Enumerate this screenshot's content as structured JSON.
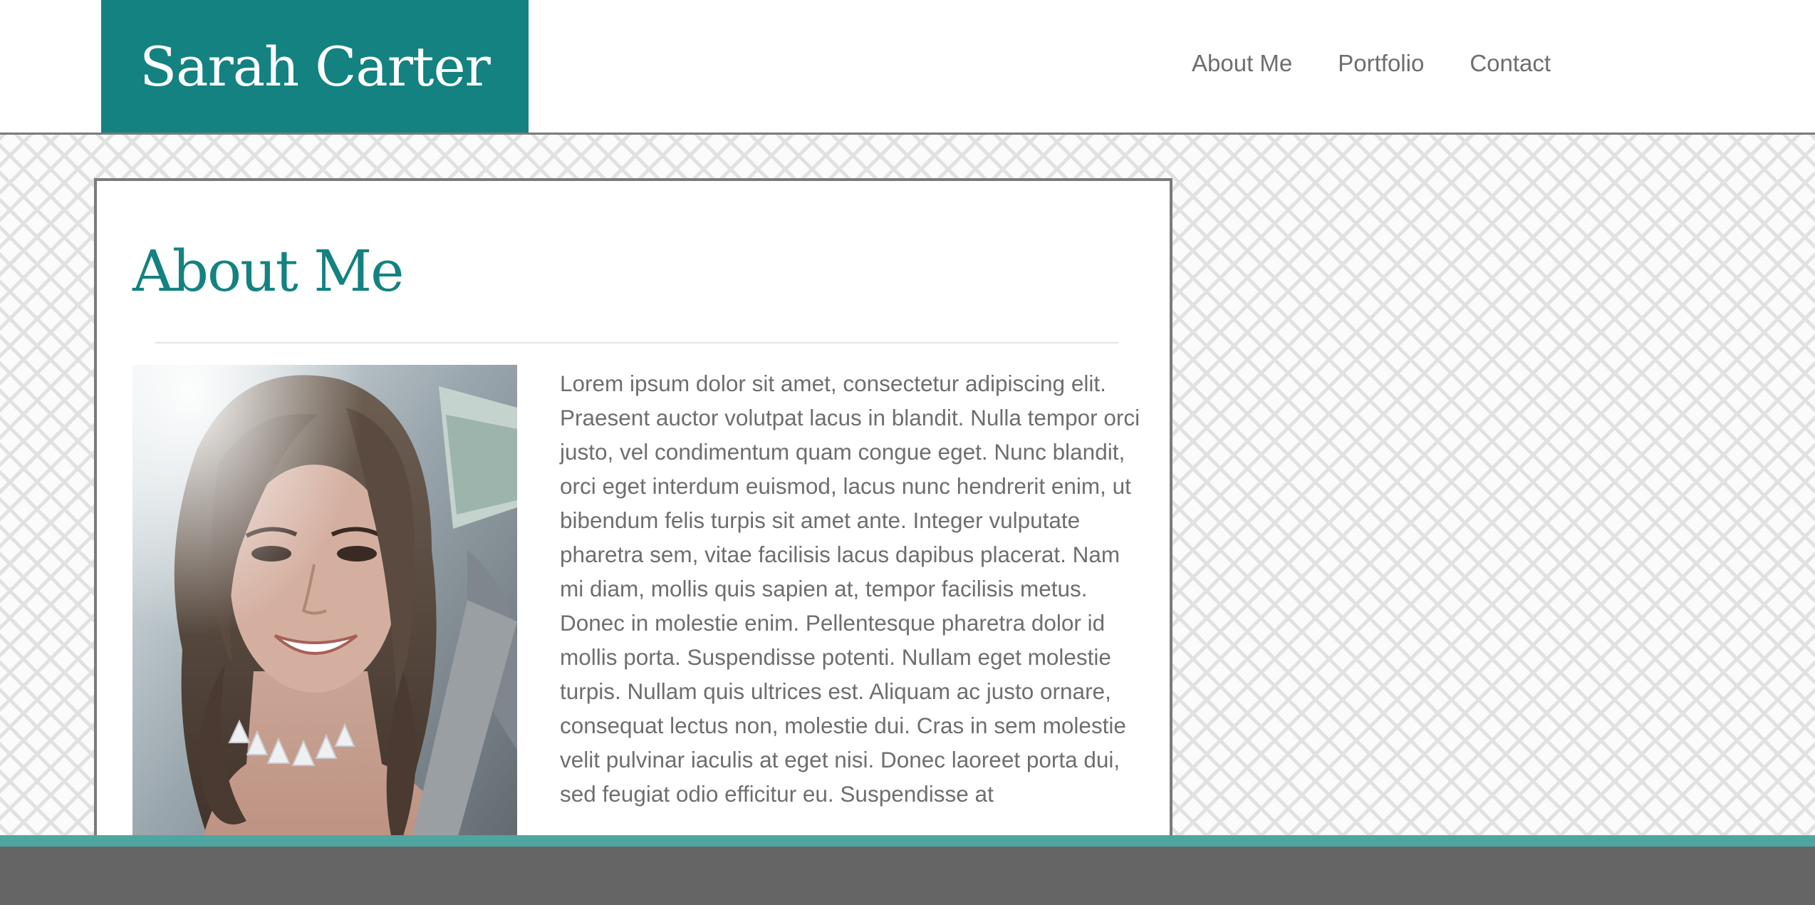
{
  "header": {
    "site_title": "Sarah Carter",
    "nav": [
      {
        "label": "About Me"
      },
      {
        "label": "Portfolio"
      },
      {
        "label": "Contact"
      }
    ]
  },
  "main": {
    "title": "About Me",
    "bio": "Lorem ipsum dolor sit amet, consectetur adipiscing elit. Praesent auctor volutpat lacus in blandit. Nulla tempor orci justo, vel condimentum quam congue eget. Nunc blandit, orci eget interdum euismod, lacus nunc hendrerit enim, ut bibendum felis turpis sit amet ante. Integer vulputate pharetra sem, vitae facilisis lacus dapibus placerat. Nam mi diam, mollis quis sapien at, tempor facilisis metus. Donec in molestie enim. Pellentesque pharetra dolor id mollis porta. Suspendisse potenti. Nullam eget molestie turpis. Nullam quis ultrices est. Aliquam ac justo ornare, consequat lectus non, molestie dui. Cras in sem molestie velit pulvinar iaculis at eget nisi. Donec laoreet porta dui, sed feugiat odio efficitur eu. Suspendisse at"
  },
  "colors": {
    "brand_teal": "#138280",
    "footer_accent": "#4fa6a0",
    "footer_bg": "#656565",
    "text_gray": "#6e6e6e"
  }
}
